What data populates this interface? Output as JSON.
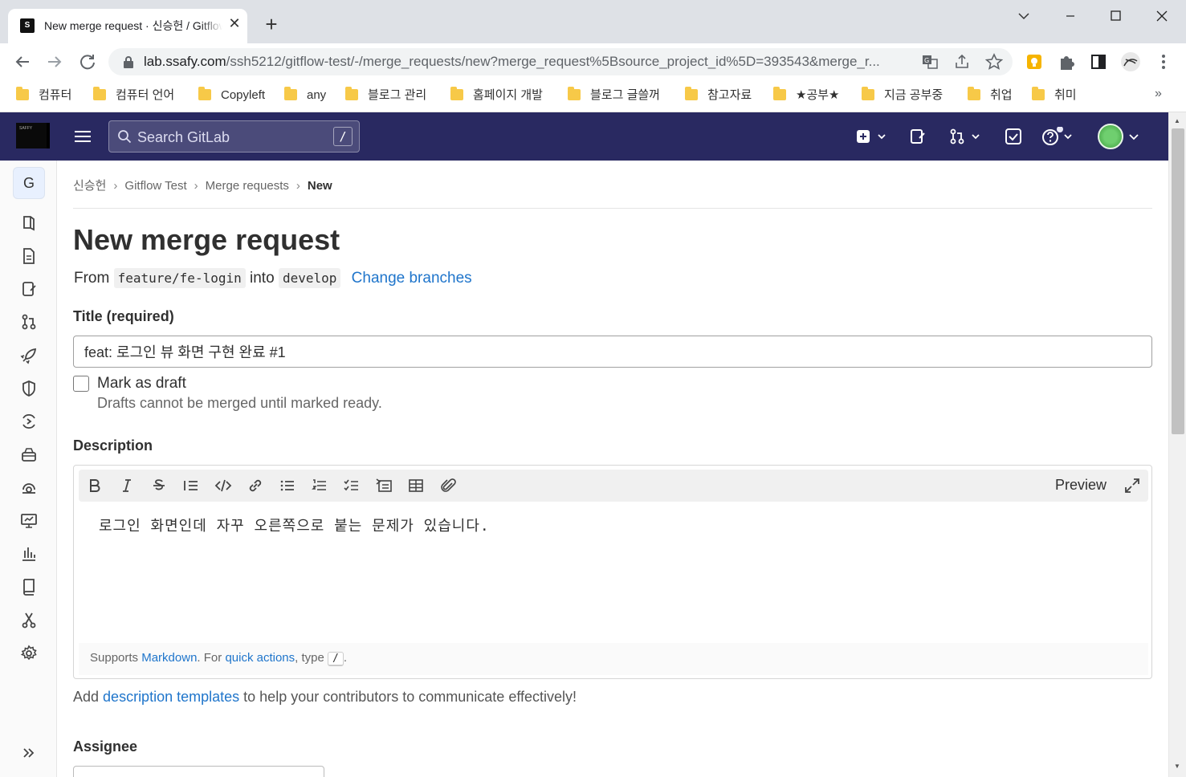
{
  "browser": {
    "tab_title": "New merge request · 신승헌 / Gitflow Test · GitLab",
    "tab_close": "✕",
    "new_tab": "+",
    "url_host": "lab.ssafy.com",
    "url_path": "/ssh5212/gitflow-test/-/merge_requests/new?merge_request%5Bsource_project_id%5D=393543&merge_r...",
    "window_controls": [
      "minimize",
      "maximize",
      "close"
    ]
  },
  "bookmarks": [
    "컴퓨터",
    "컴퓨터 언어",
    "Copyleft",
    "any",
    "블로그 관리",
    "홈페이지 개발",
    "블로그 글쓸꺼",
    "참고자료",
    "★공부★",
    "지금 공부중",
    "취업",
    "취미"
  ],
  "bookmarks_more": "»",
  "gitlab": {
    "search_placeholder": "Search GitLab",
    "search_shortcut": "/",
    "project_avatar_letter": "G"
  },
  "breadcrumb": {
    "items": [
      "신승헌",
      "Gitflow Test",
      "Merge requests"
    ],
    "current": "New"
  },
  "page": {
    "title": "New merge request",
    "from_label": "From",
    "source_branch": "feature/fe-login",
    "into_label": "into",
    "target_branch": "develop",
    "change_branches": "Change branches"
  },
  "form": {
    "title_label": "Title (required)",
    "title_value": "feat: 로그인 뷰 화면 구현 완료 #1",
    "draft_label": "Mark as draft",
    "draft_help": "Drafts cannot be merged until marked ready.",
    "description_label": "Description",
    "preview_label": "Preview",
    "description_text": "로그인 화면인데 자꾸 오른쪽으로 붙는 문제가 있습니다.",
    "footer_supports": "Supports",
    "footer_markdown": "Markdown",
    "footer_for": ". For",
    "footer_quick_actions": "quick actions",
    "footer_type": ", type",
    "footer_kbd": "/",
    "footer_end": ".",
    "templates_add": "Add",
    "templates_link": "description templates",
    "templates_rest": "to help your contributors to communicate effectively!",
    "assignee_label": "Assignee"
  },
  "colors": {
    "header_bg": "#292961",
    "link": "#1f75cb"
  }
}
